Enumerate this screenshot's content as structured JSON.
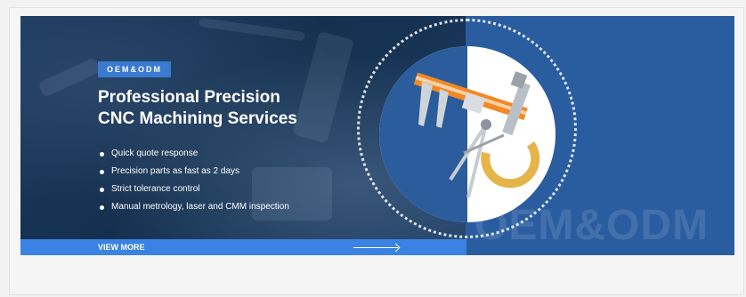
{
  "banner": {
    "badge": "OEM&ODM",
    "headline_line1": "Professional Precision",
    "headline_line2": "CNC Machining Services",
    "features": [
      "Quick quote response",
      "Precision parts as fast as 2 days",
      "Strict tolerance control",
      "Manual metrology, laser and CMM inspection"
    ],
    "cta_label": "VIEW MORE",
    "watermark": "OEM&ODM",
    "colors": {
      "left_panel": "#16314f",
      "right_panel": "#2a5da0",
      "accent_blue": "#3a82e4",
      "badge_blue": "#3a7ad0",
      "tool_orange": "#f08a24"
    },
    "icons": [
      "caliper-icon",
      "micrometer-icon",
      "compass-icon",
      "arrow-right-icon"
    ]
  }
}
